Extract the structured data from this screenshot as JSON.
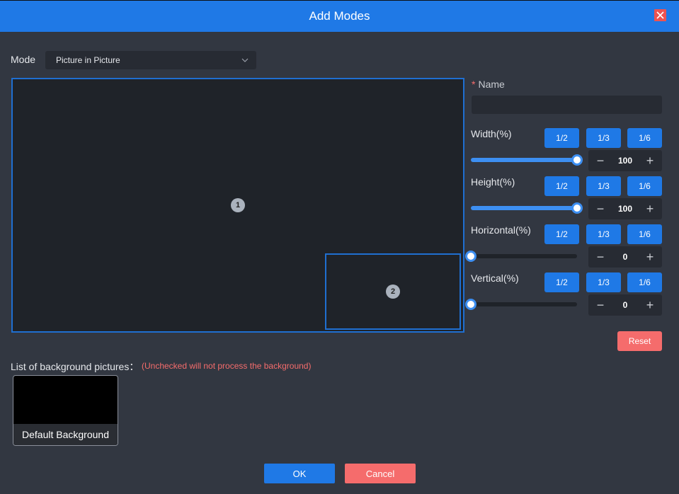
{
  "dialog": {
    "title": "Add Modes"
  },
  "mode": {
    "label": "Mode",
    "value": "Picture in Picture"
  },
  "canvas": {
    "windows": [
      {
        "number": "1"
      },
      {
        "number": "2"
      }
    ]
  },
  "name": {
    "required_mark": "*",
    "label": "Name",
    "value": "",
    "placeholder": ""
  },
  "controls": [
    {
      "label": "Width(%)",
      "buttons": [
        "1/2",
        "1/3",
        "1/6"
      ],
      "value": "100",
      "slider_fraction": 1.0
    },
    {
      "label": "Height(%)",
      "buttons": [
        "1/2",
        "1/3",
        "1/6"
      ],
      "value": "100",
      "slider_fraction": 1.0
    },
    {
      "label": "Horizontal(%)",
      "buttons": [
        "1/2",
        "1/3",
        "1/6"
      ],
      "value": "0",
      "slider_fraction": 0.0
    },
    {
      "label": "Vertical(%)",
      "buttons": [
        "1/2",
        "1/3",
        "1/6"
      ],
      "value": "0",
      "slider_fraction": 0.0
    }
  ],
  "stepper_symbols": {
    "minus": "−",
    "plus": "+"
  },
  "reset_label": "Reset",
  "background": {
    "label": "List of background pictures：",
    "note": "(Unchecked will not process the background)",
    "items": [
      {
        "caption": "Default Background"
      }
    ]
  },
  "footer": {
    "ok_label": "OK",
    "cancel_label": "Cancel"
  },
  "colors": {
    "header": "#1f79e6",
    "accent": "#1f79e6",
    "danger": "#f56c6c",
    "background": "#323741",
    "canvas": "#1f2329"
  }
}
